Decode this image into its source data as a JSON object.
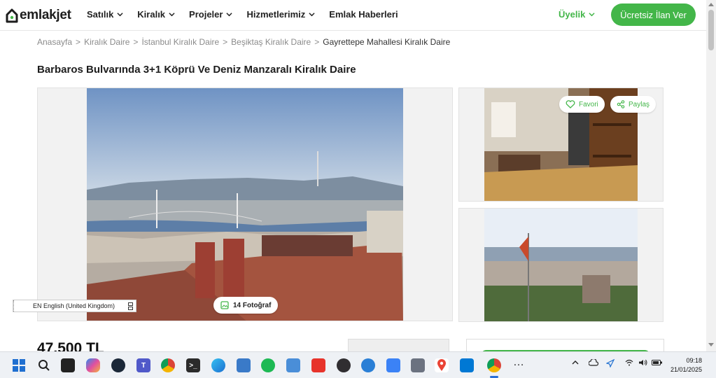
{
  "site": {
    "logo_text": "emlakjet",
    "brand_color": "#43b649"
  },
  "nav": {
    "items": [
      {
        "label": "Satılık",
        "dropdown": true
      },
      {
        "label": "Kiralık",
        "dropdown": true
      },
      {
        "label": "Projeler",
        "dropdown": true
      },
      {
        "label": "Hizmetlerimiz",
        "dropdown": true
      },
      {
        "label": "Emlak Haberleri",
        "dropdown": false
      }
    ],
    "uyelik_label": "Üyelik",
    "ilan_button_label": "Ücretsiz İlan Ver"
  },
  "breadcrumb": {
    "items": [
      "Anasayfa",
      "Kiralık Daire",
      "İstanbul Kiralık Daire",
      "Beşiktaş Kiralık Daire"
    ],
    "current": "Gayrettepe Mahallesi Kiralık Daire",
    "separator": ">"
  },
  "listing": {
    "title": "Barbaros Bulvarında 3+1 Köprü Ve Deniz Manzaralı Kiralık Daire",
    "price": "47.500 TL",
    "photo_count_label": "14 Fotoğraf",
    "favorite_label": "Favori",
    "share_label": "Paylaş"
  },
  "language_bar": {
    "label": "EN English (United Kingdom)"
  },
  "taskbar": {
    "icons": [
      "windows-start",
      "search",
      "task-view",
      "copilot",
      "steam",
      "teams",
      "chrome",
      "terminal",
      "edge",
      "photos",
      "spotify",
      "snipping-tool",
      "anydesk",
      "obs",
      "app-circle",
      "app-blue",
      "screenshot",
      "maps",
      "vscode",
      "chrome-profile",
      "more"
    ],
    "time": "09:18",
    "date": "21/01/2025"
  }
}
